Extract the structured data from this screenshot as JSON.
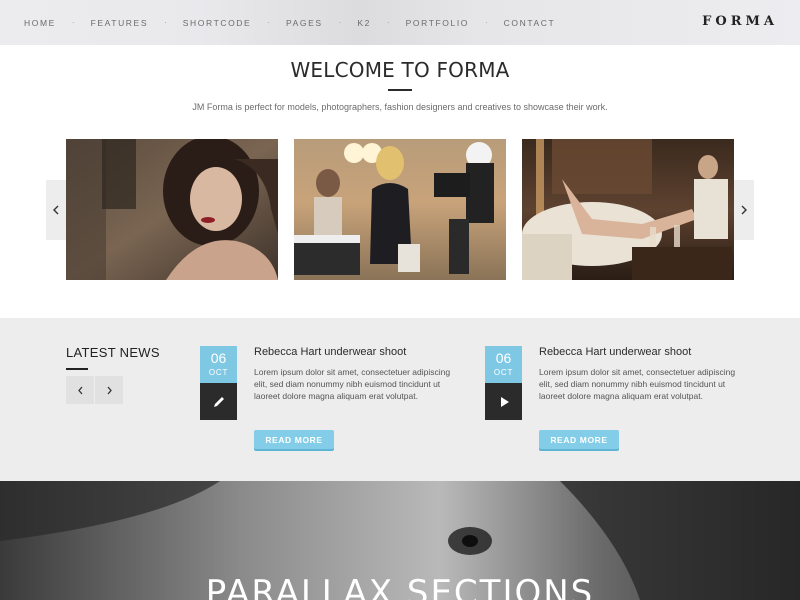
{
  "nav": {
    "items": [
      "HOME",
      "FEATURES",
      "SHORTCODE",
      "PAGES",
      "K2",
      "PORTFOLIO",
      "CONTACT"
    ],
    "separator": "·",
    "logo": "FORMA"
  },
  "welcome": {
    "title": "WELCOME TO FORMA",
    "subtitle": "JM Forma is perfect for models, photographers, fashion designers and creatives to showcase their work."
  },
  "carousel": {
    "prev_icon": "chevron-left-icon",
    "next_icon": "chevron-right-icon",
    "slides": [
      "model-portrait-photo",
      "film-set-photo",
      "lounge-couple-photo"
    ]
  },
  "news": {
    "heading": "LATEST NEWS",
    "prev_icon": "chevron-left-icon",
    "next_icon": "chevron-right-icon",
    "items": [
      {
        "day": "06",
        "month": "OCT",
        "type_icon": "pencil-icon",
        "title": "Rebecca Hart underwear shoot",
        "text": "Lorem ipsum dolor sit amet, consectetuer adipiscing elit, sed diam nonummy nibh euismod tincidunt ut laoreet dolore magna aliquam erat volutpat.",
        "button": "READ MORE"
      },
      {
        "day": "06",
        "month": "OCT",
        "type_icon": "play-icon",
        "title": "Rebecca Hart underwear shoot",
        "text": "Lorem ipsum dolor sit amet, consectetuer adipiscing elit, sed diam nonummy nibh euismod tincidunt ut laoreet dolore magna aliquam erat volutpat.",
        "button": "READ MORE"
      }
    ]
  },
  "parallax": {
    "title": "PARALLAX SECTIONS"
  },
  "colors": {
    "accent": "#7fc8e4",
    "dark": "#2b2b2b",
    "band": "#ededed"
  }
}
